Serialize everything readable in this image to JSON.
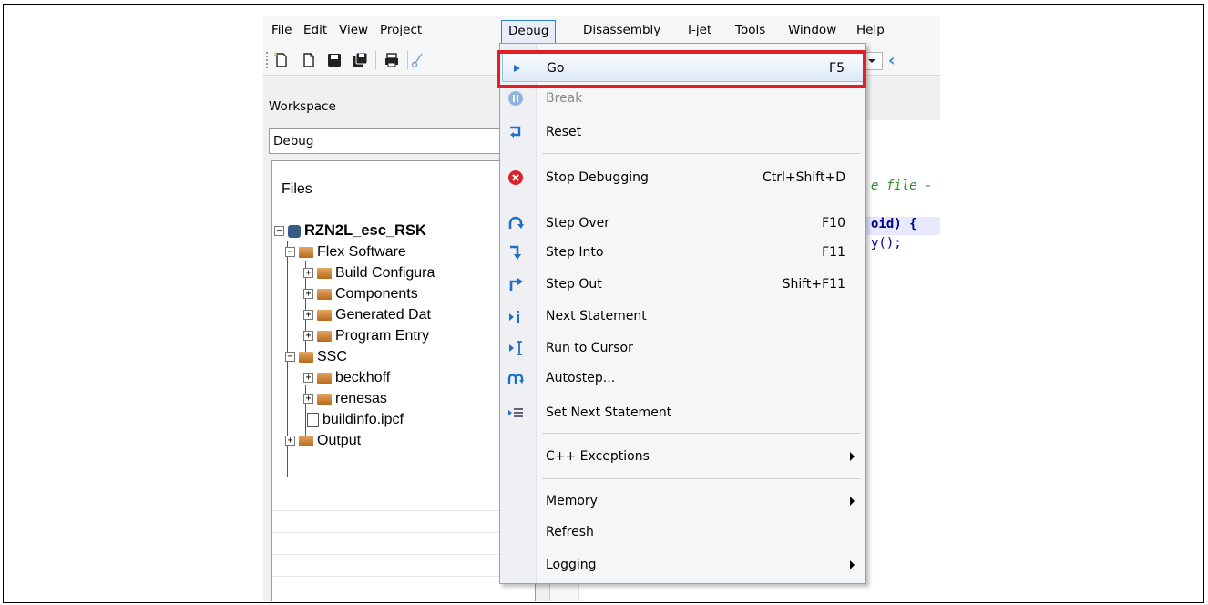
{
  "menubar": {
    "items": [
      "File",
      "Edit",
      "View",
      "Project",
      "Debug",
      "Disassembly",
      "I-jet",
      "Tools",
      "Window",
      "Help"
    ],
    "open_index": 4
  },
  "toolbar": {
    "icons": [
      "new-file-icon",
      "new-document-icon",
      "save-icon",
      "save-all-icon",
      "print-icon",
      "cut-icon"
    ]
  },
  "workspace": {
    "title": "Workspace",
    "configuration": "Debug",
    "files_header": "Files",
    "tree": [
      {
        "label": "RZN2L_esc_RSK",
        "type": "project"
      },
      {
        "label": "Flex Software",
        "type": "folder"
      },
      {
        "label": "Build Configura",
        "type": "folder"
      },
      {
        "label": "Components",
        "type": "folder"
      },
      {
        "label": "Generated Dat",
        "type": "folder"
      },
      {
        "label": "Program Entry",
        "type": "folder"
      },
      {
        "label": "SSC",
        "type": "folder"
      },
      {
        "label": "beckhoff",
        "type": "folder"
      },
      {
        "label": "renesas",
        "type": "folder"
      },
      {
        "label": "buildinfo.ipcf",
        "type": "file"
      },
      {
        "label": "Output",
        "type": "folder"
      }
    ]
  },
  "editor": {
    "lines": [
      "e file -",
      "oid) {",
      "y();"
    ]
  },
  "debug_menu": {
    "items": [
      {
        "label": "Go",
        "shortcut": "F5",
        "icon": "go-icon",
        "highlighted": true
      },
      {
        "label": "Break",
        "shortcut": "",
        "icon": "break-icon",
        "disabled": true
      },
      {
        "label": "Reset",
        "shortcut": "",
        "icon": "reset-icon"
      },
      {
        "label": "Stop Debugging",
        "shortcut": "Ctrl+Shift+D",
        "icon": "stop-icon"
      },
      {
        "label": "Step Over",
        "shortcut": "F10",
        "icon": "step-over-icon"
      },
      {
        "label": "Step Into",
        "shortcut": "F11",
        "icon": "step-into-icon"
      },
      {
        "label": "Step Out",
        "shortcut": "Shift+F11",
        "icon": "step-out-icon"
      },
      {
        "label": "Next Statement",
        "shortcut": "",
        "icon": "next-statement-icon"
      },
      {
        "label": "Run to Cursor",
        "shortcut": "",
        "icon": "run-to-cursor-icon"
      },
      {
        "label": "Autostep...",
        "shortcut": "",
        "icon": "autostep-icon"
      },
      {
        "label": "Set Next Statement",
        "shortcut": "",
        "icon": "set-next-statement-icon"
      },
      {
        "label": "C++ Exceptions",
        "shortcut": "",
        "submenu": true
      },
      {
        "label": "Memory",
        "shortcut": "",
        "submenu": true
      },
      {
        "label": "Refresh",
        "shortcut": ""
      },
      {
        "label": "Logging",
        "shortcut": "",
        "submenu": true
      }
    ]
  },
  "colors": {
    "highlight_box": "#e31e24",
    "menu_hover": "#dde9f7",
    "folder": "#c9843a"
  }
}
